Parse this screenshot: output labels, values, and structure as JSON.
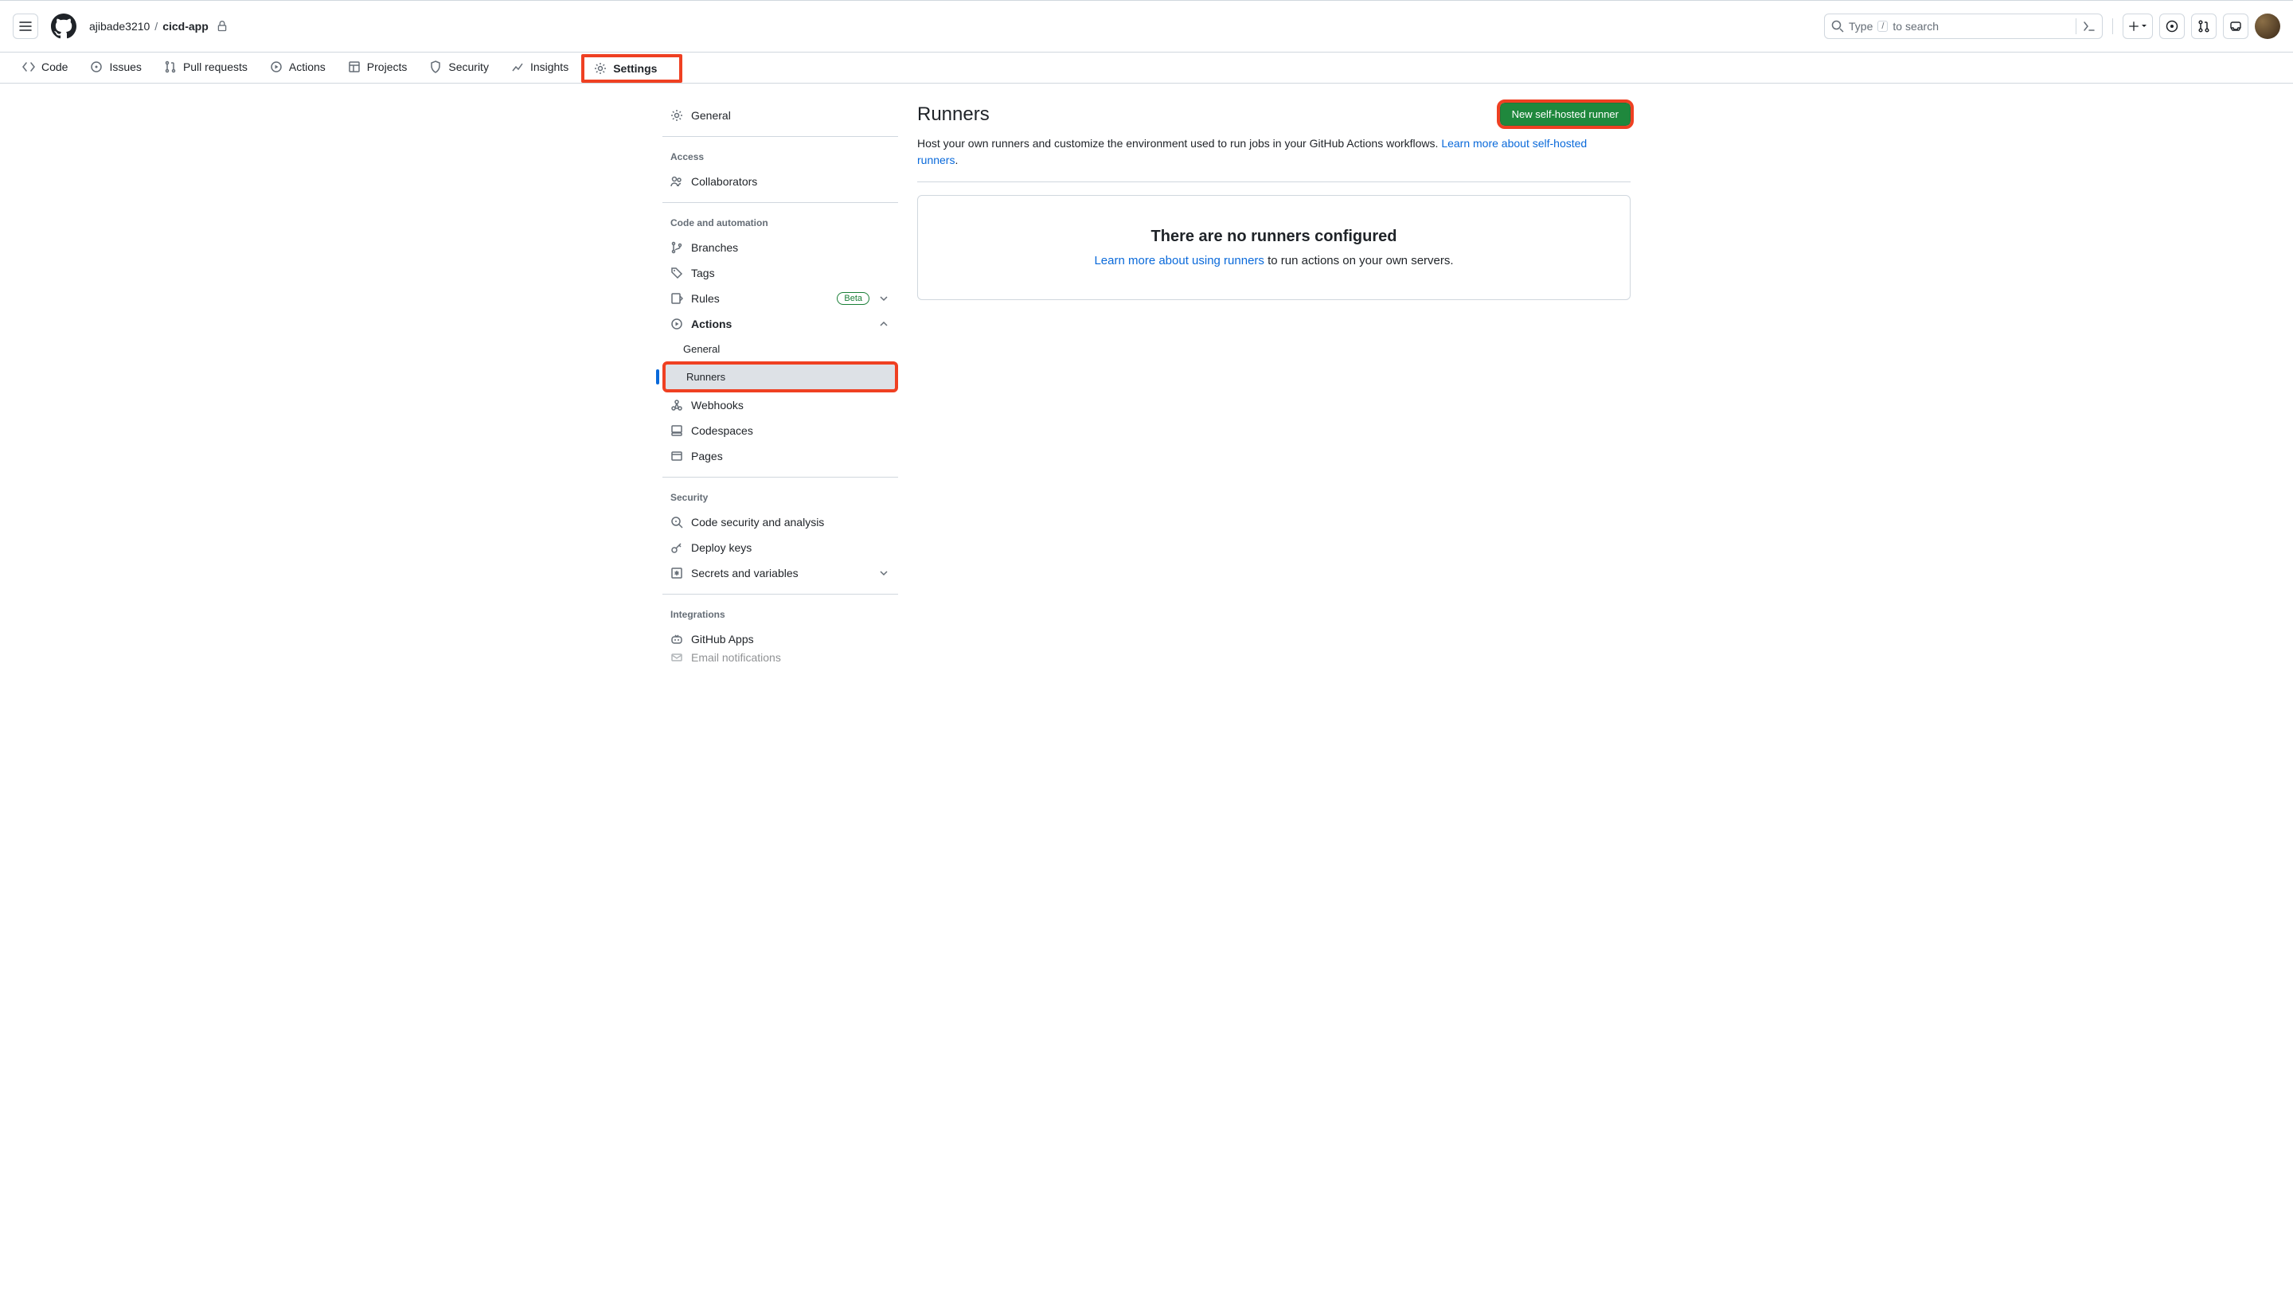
{
  "header": {
    "owner": "ajibade3210",
    "sep": "/",
    "repo": "cicd-app",
    "search_prefix": "Type",
    "search_slash": "/",
    "search_suffix": "to search"
  },
  "repo_nav": {
    "items": [
      {
        "label": "Code"
      },
      {
        "label": "Issues"
      },
      {
        "label": "Pull requests"
      },
      {
        "label": "Actions"
      },
      {
        "label": "Projects"
      },
      {
        "label": "Security"
      },
      {
        "label": "Insights"
      },
      {
        "label": "Settings"
      }
    ]
  },
  "sidebar": {
    "general": "General",
    "access_heading": "Access",
    "collaborators": "Collaborators",
    "code_heading": "Code and automation",
    "branches": "Branches",
    "tags": "Tags",
    "rules": "Rules",
    "rules_badge": "Beta",
    "actions": "Actions",
    "actions_sub_general": "General",
    "actions_sub_runners": "Runners",
    "webhooks": "Webhooks",
    "codespaces": "Codespaces",
    "pages": "Pages",
    "security_heading": "Security",
    "code_security": "Code security and analysis",
    "deploy_keys": "Deploy keys",
    "secrets": "Secrets and variables",
    "integrations_heading": "Integrations",
    "github_apps": "GitHub Apps",
    "email_notifications": "Email notifications"
  },
  "main": {
    "title": "Runners",
    "button_new": "New self-hosted runner",
    "desc_text": "Host your own runners and customize the environment used to run jobs in your GitHub Actions workflows. ",
    "desc_link": "Learn more about self-hosted runners",
    "desc_period": ".",
    "empty_title": "There are no runners configured",
    "empty_link": "Learn more about using runners",
    "empty_suffix": " to run actions on your own servers."
  }
}
